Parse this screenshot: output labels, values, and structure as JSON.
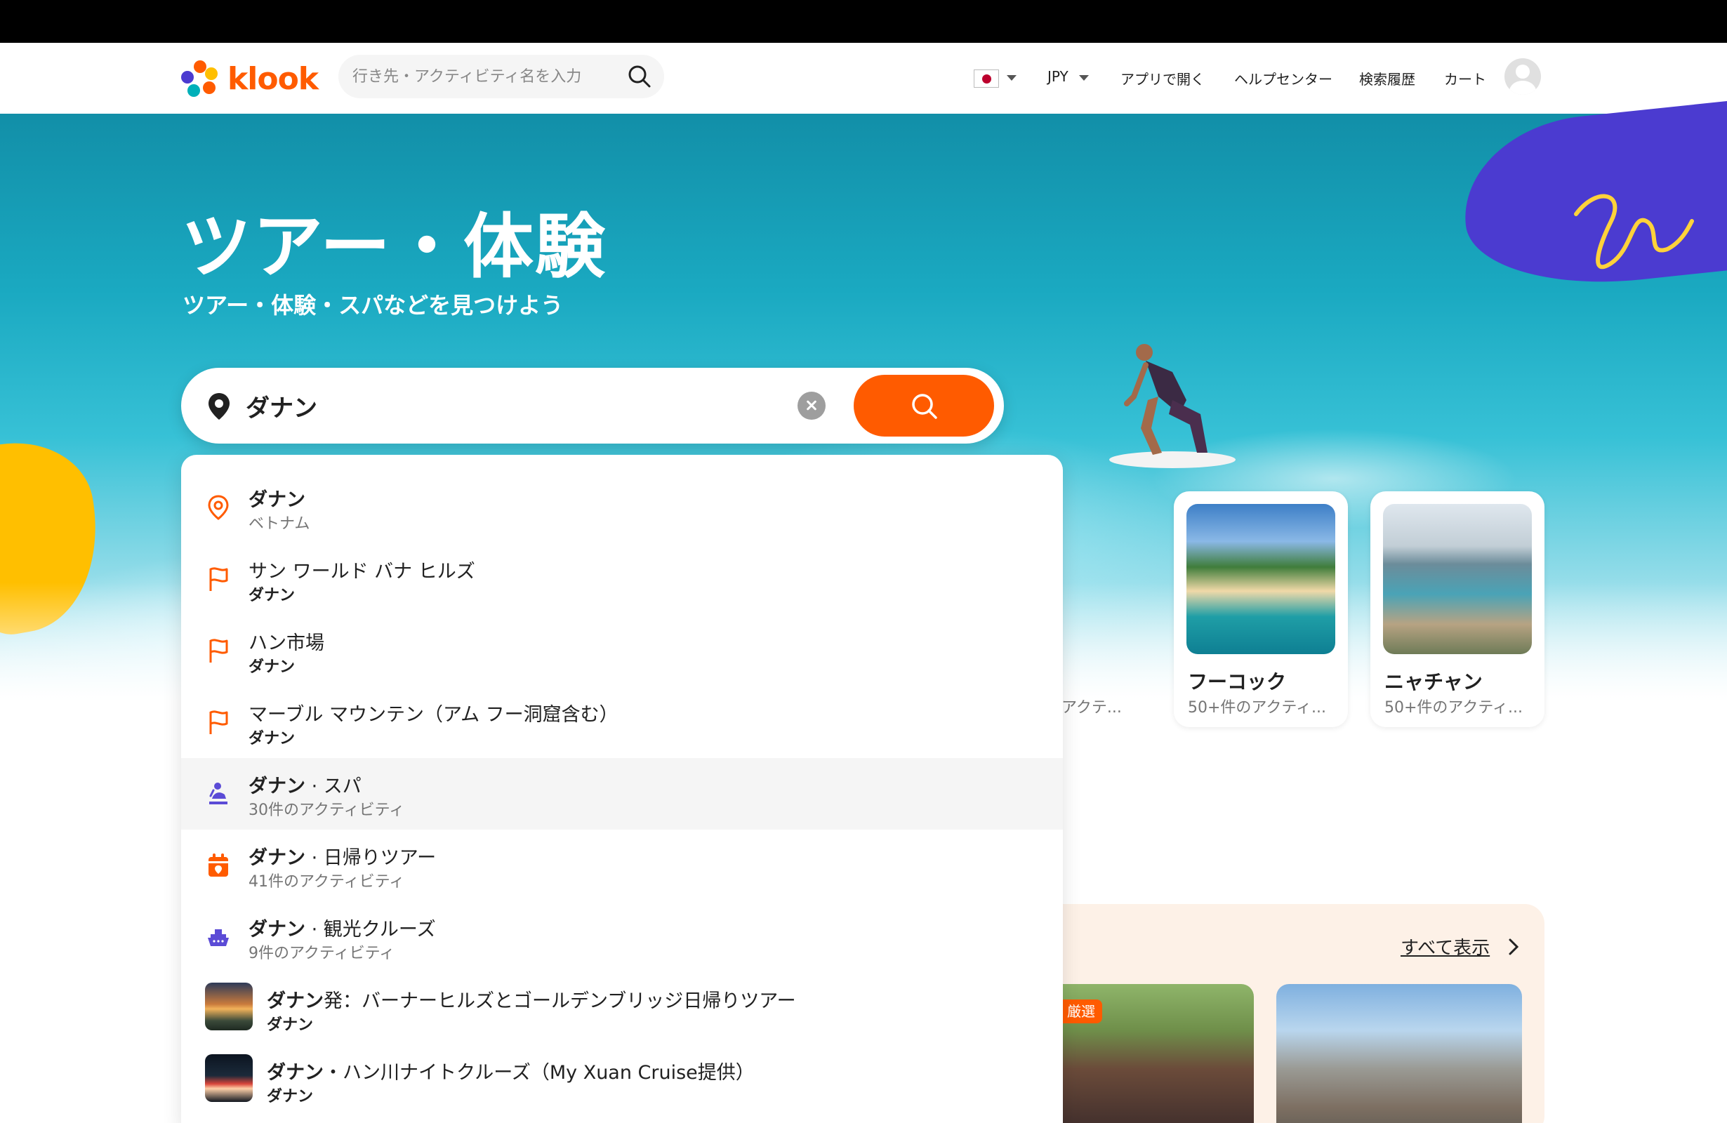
{
  "header": {
    "logo_text": "klook",
    "search_placeholder": "行き先・アクティビティ名を入力",
    "currency": "JPY",
    "nav": {
      "open_app": "アプリで開く",
      "help": "ヘルプセンター",
      "history": "検索履歴",
      "cart": "カート"
    }
  },
  "hero": {
    "title": "ツアー・体験",
    "subtitle": "ツアー・体験・スパなどを見つけよう",
    "search_value": "ダナン"
  },
  "destinations": [
    {
      "name": "",
      "count": "アクテ..."
    },
    {
      "name": "フーコック",
      "count": "50+件のアクティ..."
    },
    {
      "name": "ニャチャン",
      "count": "50+件のアクティ..."
    }
  ],
  "promo": {
    "see_all": "すべて表示",
    "badge": "厳選"
  },
  "suggestions": [
    {
      "icon": "location-pin-icon",
      "title_bold": "ダナン",
      "title_rest": "",
      "sub": "ベトナム",
      "sub_bold": false
    },
    {
      "icon": "flag-icon",
      "title_bold": "",
      "title_rest": "サン ワールド バナ ヒルズ",
      "sub": "ダナン",
      "sub_bold": true
    },
    {
      "icon": "flag-icon",
      "title_bold": "",
      "title_rest": "ハン市場",
      "sub": "ダナン",
      "sub_bold": true
    },
    {
      "icon": "flag-icon",
      "title_bold": "",
      "title_rest": "マーブル マウンテン（アム フー洞窟含む）",
      "sub": "ダナン",
      "sub_bold": true
    },
    {
      "icon": "spa-icon",
      "title_bold": "ダナン",
      "title_rest": " · スパ",
      "sub": "30件のアクティビティ",
      "sub_bold": false
    },
    {
      "icon": "calendar-icon",
      "title_bold": "ダナン",
      "title_rest": " · 日帰りツアー",
      "sub": "41件のアクティビティ",
      "sub_bold": false
    },
    {
      "icon": "cruise-ship-icon",
      "title_bold": "ダナン",
      "title_rest": " · 観光クルーズ",
      "sub": "9件のアクティビティ",
      "sub_bold": false
    },
    {
      "icon": "thumbnail-image",
      "title_bold": "ダナン",
      "title_rest": "発：バーナーヒルズとゴールデンブリッジ日帰りツアー",
      "sub": "ダナン",
      "sub_bold": true
    },
    {
      "icon": "thumbnail-image",
      "title_bold": "ダナン",
      "title_rest": "・ハン川ナイトクルーズ（My Xuan Cruise提供）",
      "sub": "ダナン",
      "sub_bold": true
    }
  ],
  "colors": {
    "brand_orange": "#ff5b00",
    "accent_purple": "#4b3bd0",
    "accent_yellow": "#ffbf00"
  }
}
